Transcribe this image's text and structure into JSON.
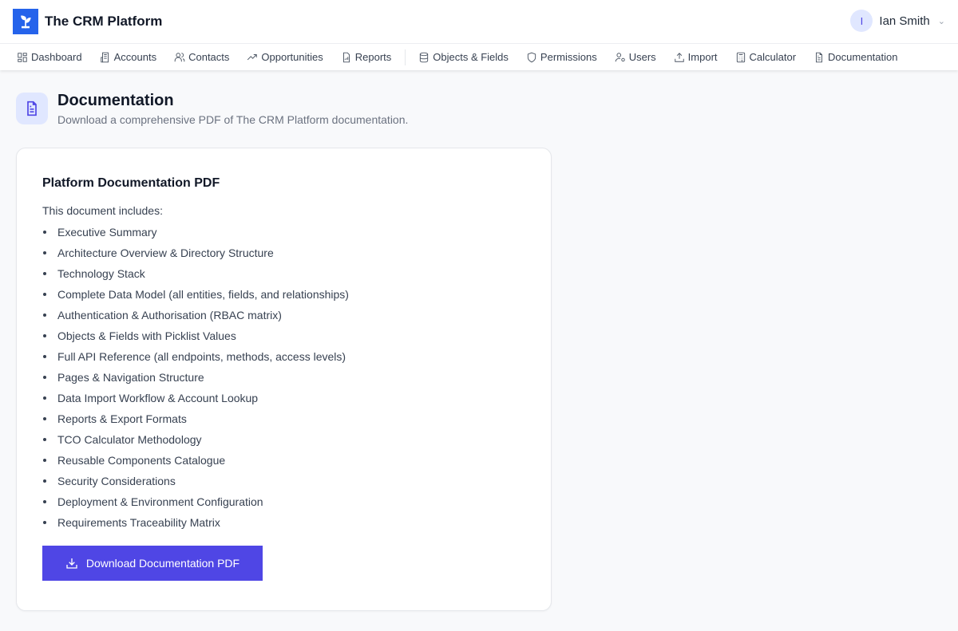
{
  "app": {
    "title": "The CRM Platform",
    "logo_icon": "sprout-icon",
    "brand_color": "#2563eb"
  },
  "user": {
    "initial": "I",
    "name": "Ian Smith"
  },
  "nav": [
    {
      "label": "Dashboard",
      "icon": "dashboard-icon"
    },
    {
      "label": "Accounts",
      "icon": "building-icon"
    },
    {
      "label": "Contacts",
      "icon": "users-icon"
    },
    {
      "label": "Opportunities",
      "icon": "trending-up-icon"
    },
    {
      "label": "Reports",
      "icon": "report-icon"
    },
    {
      "label": "Objects & Fields",
      "icon": "database-icon"
    },
    {
      "label": "Permissions",
      "icon": "shield-icon"
    },
    {
      "label": "Users",
      "icon": "user-cog-icon"
    },
    {
      "label": "Import",
      "icon": "upload-icon"
    },
    {
      "label": "Calculator",
      "icon": "calculator-icon"
    },
    {
      "label": "Documentation",
      "icon": "file-text-icon"
    }
  ],
  "page": {
    "title": "Documentation",
    "subtitle": "Download a comprehensive PDF of The CRM Platform documentation."
  },
  "card": {
    "title": "Platform Documentation PDF",
    "intro": "This document includes:",
    "items": [
      "Executive Summary",
      "Architecture Overview & Directory Structure",
      "Technology Stack",
      "Complete Data Model (all entities, fields, and relationships)",
      "Authentication & Authorisation (RBAC matrix)",
      "Objects & Fields with Picklist Values",
      "Full API Reference (all endpoints, methods, access levels)",
      "Pages & Navigation Structure",
      "Data Import Workflow & Account Lookup",
      "Reports & Export Formats",
      "TCO Calculator Methodology",
      "Reusable Components Catalogue",
      "Security Considerations",
      "Deployment & Environment Configuration",
      "Requirements Traceability Matrix"
    ],
    "button": "Download Documentation PDF",
    "accent": "#4f46e5"
  }
}
